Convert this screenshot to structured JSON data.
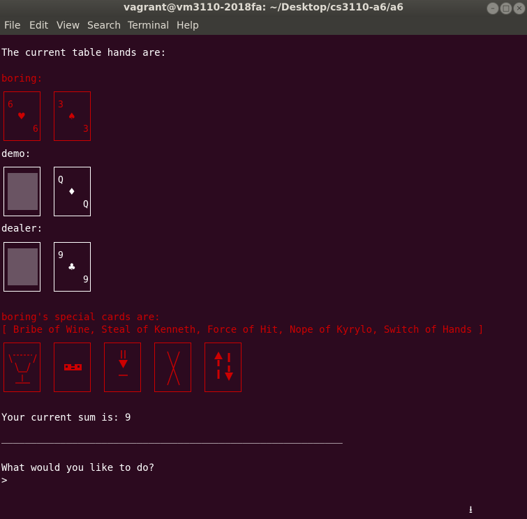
{
  "window": {
    "title": "vagrant@vm3110-2018fa: ~/Desktop/cs3110-a6/a6"
  },
  "menu": [
    "File",
    "Edit",
    "View",
    "Search",
    "Terminal",
    "Help"
  ],
  "terminal": {
    "header": "The current table hands are:",
    "hands": [
      {
        "name": "boring:",
        "cards": [
          {
            "rank": "6",
            "suit": "♥"
          },
          {
            "rank": "3",
            "suit": "♠"
          }
        ]
      },
      {
        "name": "demo:",
        "cards": [
          {
            "hidden": true
          },
          {
            "rank": "Q",
            "suit": "♦"
          }
        ]
      },
      {
        "name": "dealer:",
        "cards": [
          {
            "hidden": true
          },
          {
            "rank": "9",
            "suit": "♣"
          }
        ]
      }
    ],
    "special_header": "boring's special cards are:",
    "special_list": "[ Bribe of Wine, Steal of Kenneth, Force of Hit, Nope of Kyrylo, Switch of Hands ]",
    "sum_line": "Your current sum is: 9",
    "separator": "__________________________________________________________",
    "prompt_question": "What would you like to do?",
    "prompt": ">",
    "colors": {
      "bg": "#2c0a1f",
      "red": "#cc0000",
      "white": "#ffffff"
    }
  }
}
